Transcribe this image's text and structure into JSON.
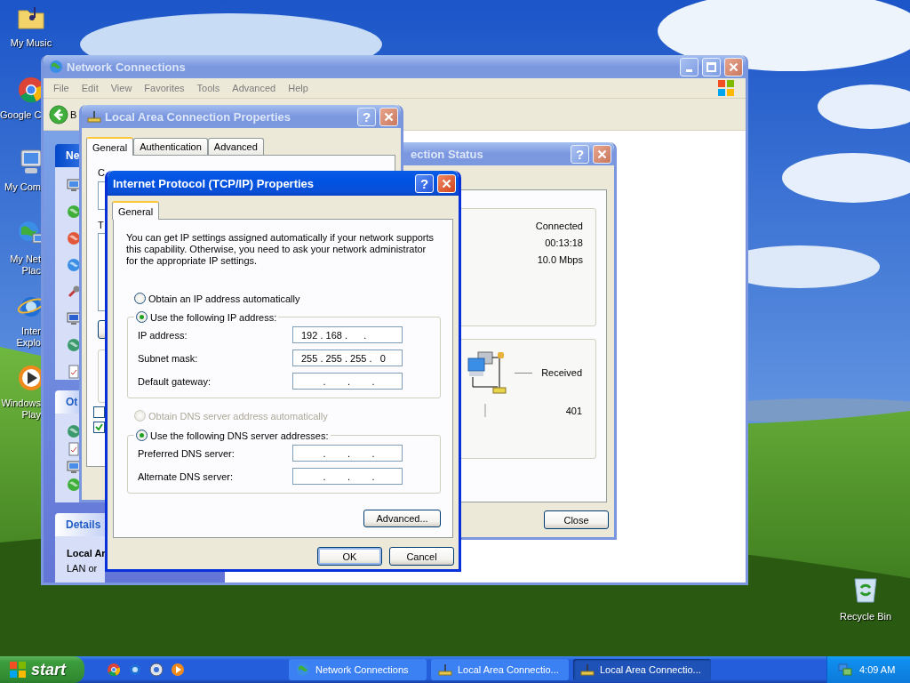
{
  "desktop_icons": [
    {
      "kind": "music",
      "label_lines": [
        "My Music"
      ],
      "cut_by_window": false
    },
    {
      "kind": "browser",
      "label_lines": [
        "Google C"
      ],
      "cut_by_window": true
    },
    {
      "kind": "computer",
      "label_lines": [
        "My Com"
      ],
      "cut_by_window": true
    },
    {
      "kind": "network",
      "label_lines": [
        "My Net",
        "Plac"
      ],
      "cut_by_window": true
    },
    {
      "kind": "internet",
      "label_lines": [
        "Inter",
        "Explo"
      ],
      "cut_by_window": true
    },
    {
      "kind": "media",
      "label_lines": [
        "Windows",
        "Play"
      ],
      "cut_by_window": true
    }
  ],
  "recycle_bin": {
    "label": "Recycle Bin"
  },
  "network_connections_window": {
    "title": "Network Connections",
    "active": false,
    "menu": [
      "File",
      "Edit",
      "View",
      "Favorites",
      "Tools",
      "Advanced",
      "Help"
    ],
    "back_label": "B",
    "task_pane": {
      "first_header": "Ne",
      "second_header": "Ot",
      "details_header": "Details",
      "details_title": "Local Ar",
      "details_text": "LAN or"
    }
  },
  "lan_properties_window": {
    "title": "Local Area Connection Properties",
    "active": false,
    "help_button": "?",
    "tabs": [
      {
        "label": "General",
        "selected": true
      },
      {
        "label": "Authentication",
        "selected": false
      },
      {
        "label": "Advanced",
        "selected": false
      }
    ],
    "label_1": "C",
    "label_2": "T",
    "checkboxes": [
      {
        "checked": false
      },
      {
        "checked": true
      }
    ]
  },
  "status_window": {
    "title": "ection Status",
    "active": false,
    "help_button": "?",
    "status": "Connected",
    "duration": "00:13:18",
    "speed": "10.0 Mbps",
    "activity_label": "Received",
    "received": "401",
    "close_button": "Close"
  },
  "tcpip_dialog": {
    "title": "Internet Protocol (TCP/IP) Properties",
    "active": true,
    "help_button": "?",
    "tabs": [
      {
        "label": "General",
        "selected": true
      }
    ],
    "intro": "You can get IP settings assigned automatically if your network supports this capability. Otherwise, you need to ask your network administrator for the appropriate IP settings.",
    "ip_options": [
      {
        "label": "Obtain an IP address automatically",
        "selected": false,
        "disabled": false
      },
      {
        "label": "Use the following IP address:",
        "selected": true,
        "disabled": false
      }
    ],
    "ip_fields": [
      {
        "label": "IP address:",
        "value": "192 . 168 .      ."
      },
      {
        "label": "Subnet mask:",
        "value": "255 . 255 . 255 .   0"
      },
      {
        "label": "Default gateway:",
        "value": "        .        .        ."
      }
    ],
    "dns_options": [
      {
        "label": "Obtain DNS server address automatically",
        "selected": false,
        "disabled": true
      },
      {
        "label": "Use the following DNS server addresses:",
        "selected": true,
        "disabled": false
      }
    ],
    "dns_fields": [
      {
        "label": "Preferred DNS server:",
        "value": "        .        .        ."
      },
      {
        "label": "Alternate DNS server:",
        "value": "        .        .        ."
      }
    ],
    "advanced_button": "Advanced...",
    "ok_button": "OK",
    "cancel_button": "Cancel"
  },
  "taskbar": {
    "start_label": "start",
    "tasks": [
      {
        "label": "Network Connections",
        "kind": "globe",
        "selected": false
      },
      {
        "label": "Local Area Connectio...",
        "kind": "connector",
        "selected": false
      },
      {
        "label": "Local Area Connectio...",
        "kind": "connector",
        "selected": true
      }
    ],
    "clock": "4:09 AM"
  }
}
